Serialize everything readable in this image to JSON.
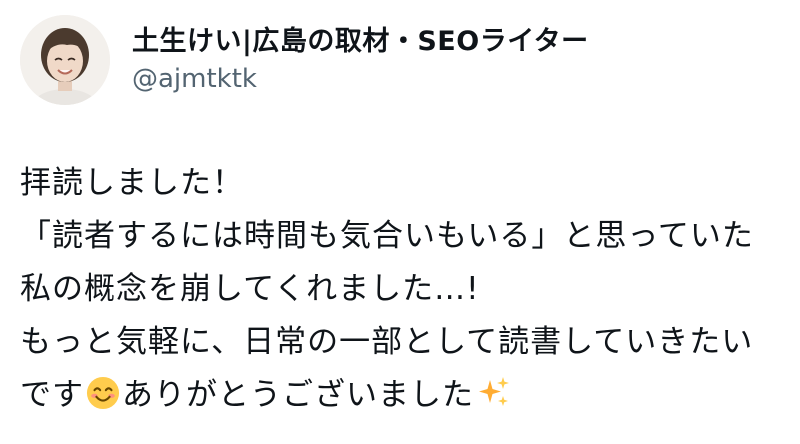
{
  "author": {
    "display_name": "土生けい|広島の取材・SEOライター",
    "handle": "@ajmtktk",
    "avatar_icon": "profile-photo"
  },
  "tweet": {
    "line1": "拝読しました！",
    "line2": "「読者するには時間も気合いもいる」と思っていた",
    "line3": "私の概念を崩してくれました…!",
    "line4": "もっと気軽に、日常の一部として読書していきたい",
    "line5_before": "です",
    "line5_after": "ありがとうございました",
    "emoji_1": "smiling-face-emoji",
    "emoji_2": "sparkles-emoji"
  },
  "colors": {
    "text": "#0f1419",
    "secondary_text": "#536471",
    "background": "#ffffff"
  }
}
